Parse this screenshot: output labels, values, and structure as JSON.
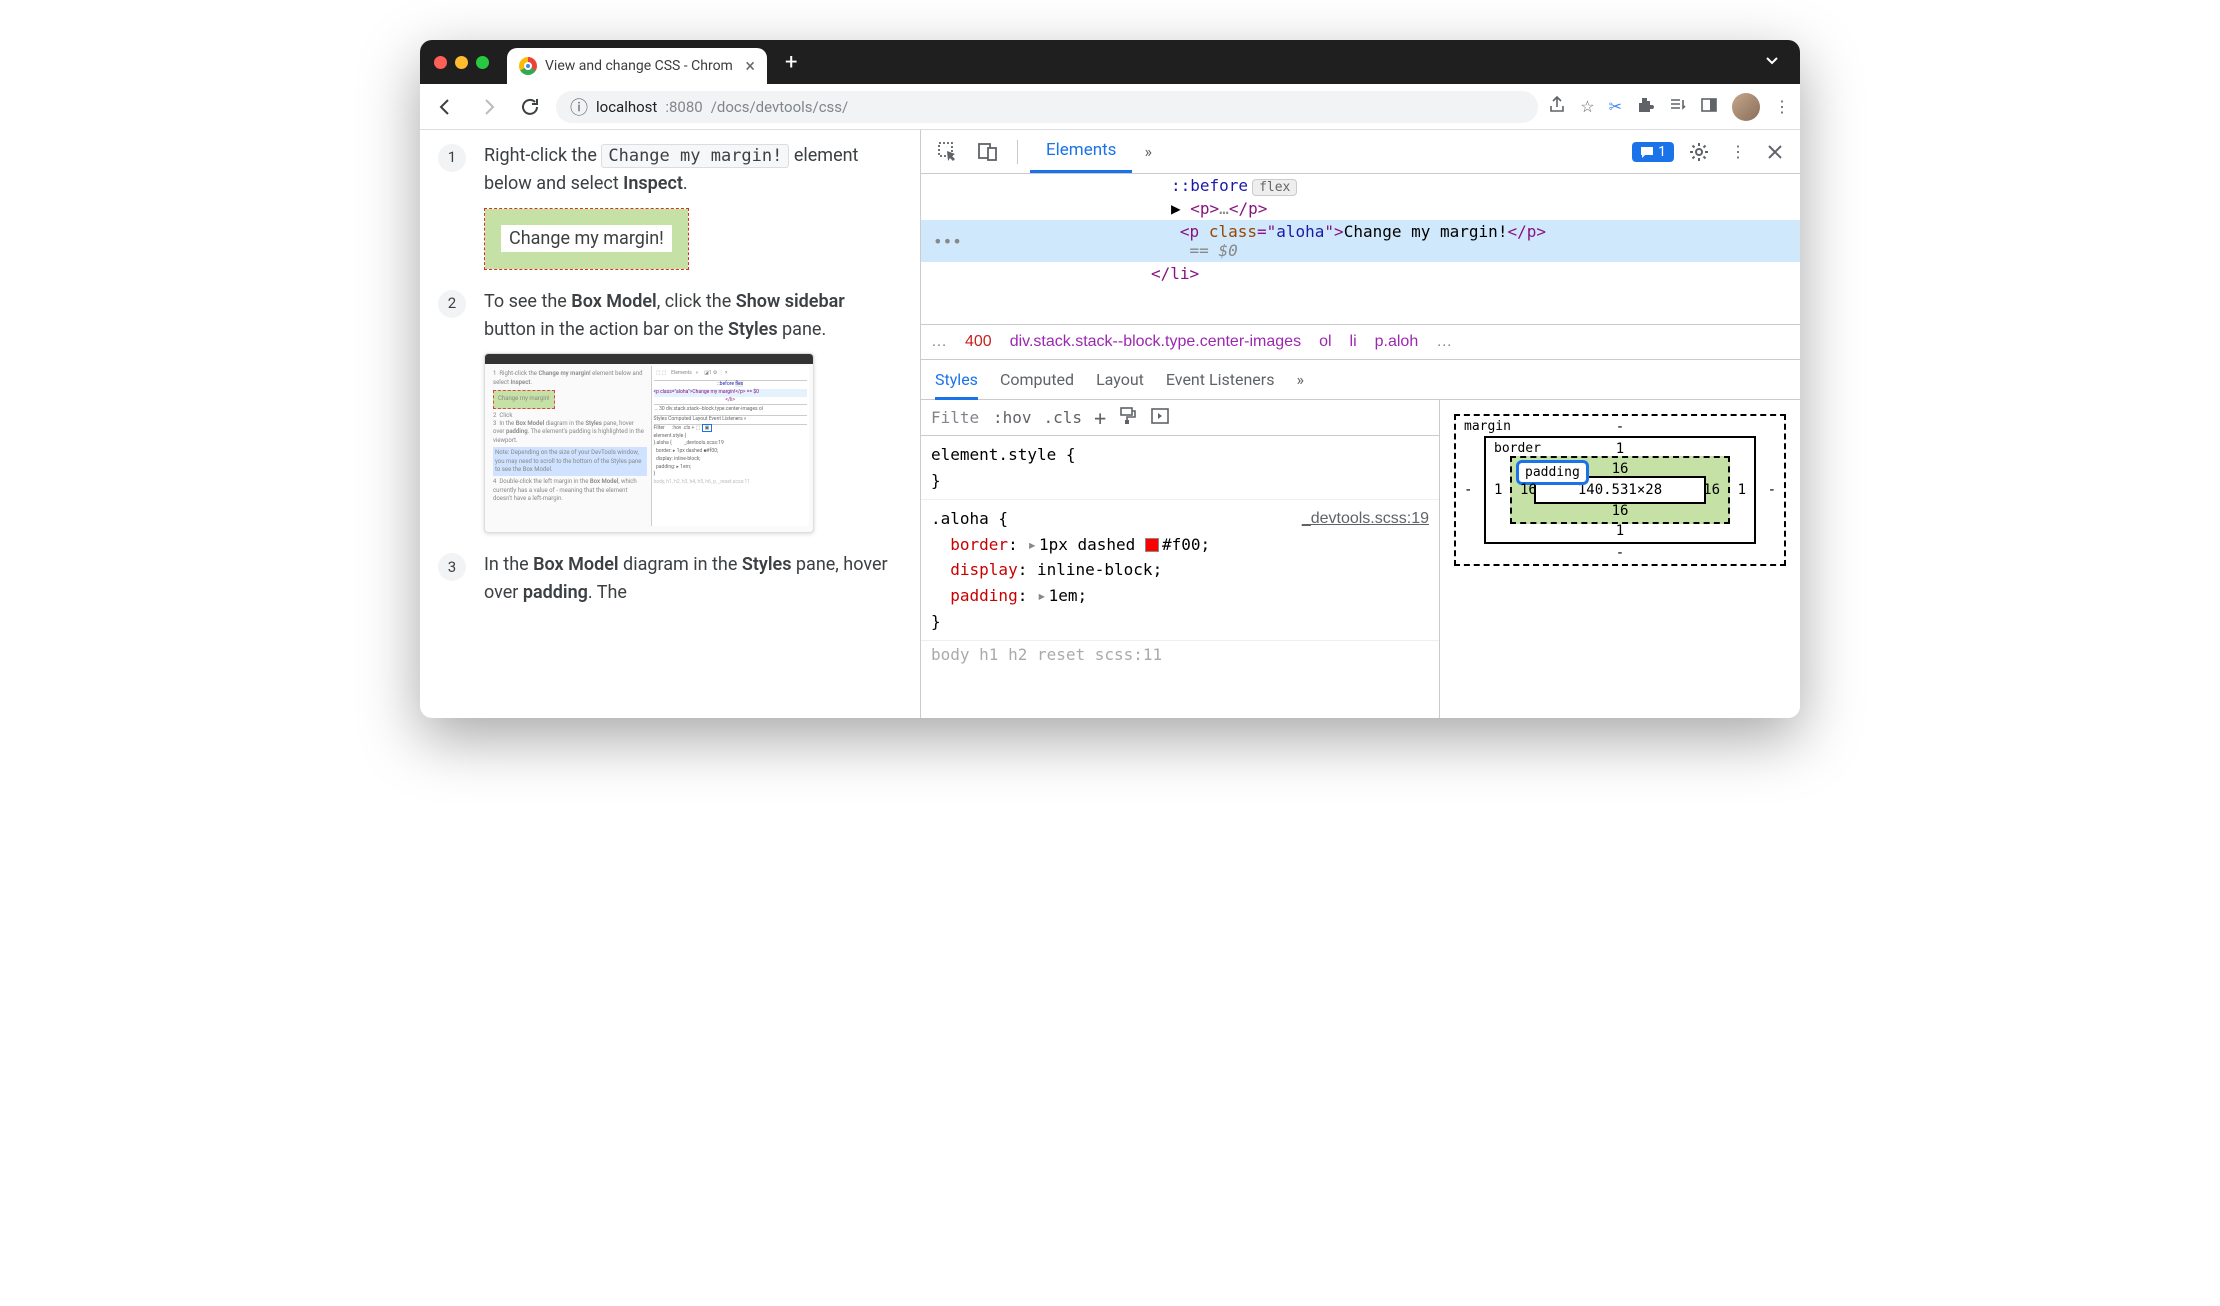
{
  "browser": {
    "tab_title": "View and change CSS - Chrom",
    "url_host": "localhost",
    "url_port": ":8080",
    "url_path": "/docs/devtools/css/"
  },
  "page": {
    "step1_pre": "Right-click the ",
    "step1_code": "Change my margin!",
    "step1_post": " element below and select ",
    "step1_bold": "Inspect",
    "step1_end": ".",
    "margin_demo": "Change my margin!",
    "step2_a": "To see the ",
    "step2_b1": "Box Model",
    "step2_c": ", click the ",
    "step2_b2": "Show sidebar",
    "step2_d": " button in the action bar on the ",
    "step2_b3": "Styles",
    "step2_e": " pane.",
    "step3_a": "In the ",
    "step3_b1": "Box Model",
    "step3_c": " diagram in the ",
    "step3_b2": "Styles",
    "step3_d": " pane, hover over ",
    "step3_b3": "padding",
    "step3_e": ". The"
  },
  "devtools": {
    "tabs": {
      "elements": "Elements"
    },
    "badge_count": "1",
    "dom": {
      "before": "::before",
      "flex_pill": "flex",
      "p_collapsed_open": "<p>",
      "p_collapsed_dots": "…",
      "p_collapsed_close": "</p>",
      "sel_open": "<p ",
      "sel_attr": "class",
      "sel_eq": "=\"",
      "sel_val": "aloha",
      "sel_close_attr": "\">",
      "sel_text": "Change my margin!",
      "sel_close": "</p>",
      "eq0": "== $0",
      "li_close": "</li>"
    },
    "crumbs": {
      "dots": "…",
      "c400": "400",
      "main": "div.stack.stack--block.type.center-images",
      "ol": "ol",
      "li": "li",
      "paloh": "p.aloh",
      "dots2": "…"
    },
    "subtabs": {
      "styles": "Styles",
      "computed": "Computed",
      "layout": "Layout",
      "listeners": "Event Listeners"
    },
    "styles": {
      "filter_ph": "Filte",
      "hov": ":hov",
      "cls": ".cls",
      "r1_sel": "element.style {",
      "r1_close": "}",
      "r2_sel": ".aloha {",
      "r2_file": "_devtools.scss:19",
      "r2_p1": "border",
      "r2_v1": "1px dashed ",
      "r2_v1b": "#f00",
      "r2_p2": "display",
      "r2_v2": "inline-block",
      "r2_p3": "padding",
      "r2_v3": "1em",
      "r2_close": "}",
      "r3_dim": "body  h1  h2             reset scss:11"
    },
    "boxmodel": {
      "margin_label": "margin",
      "border_label": "border",
      "padding_label": "padding",
      "content": "140.531×28",
      "margin_vals": "-",
      "border_vals": "1",
      "padding_vals": "16"
    }
  }
}
